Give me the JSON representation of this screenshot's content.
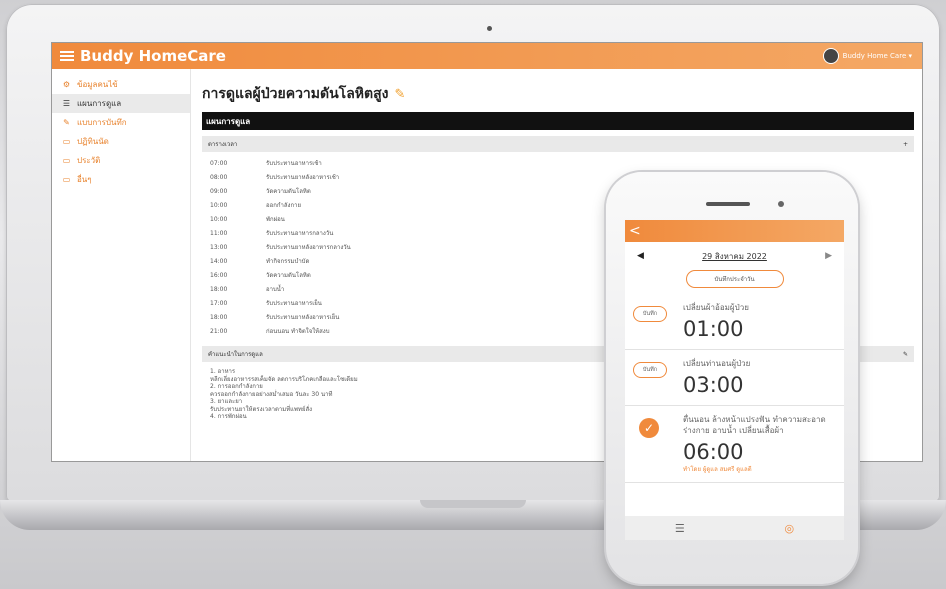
{
  "laptop_app": {
    "brand": "Buddy HomeCare",
    "user_menu": "Buddy Home Care ▾",
    "sidebar": [
      {
        "label": "ข้อมูลคนไข้",
        "icon": "gear-icon",
        "glyph": "⚙",
        "active": false
      },
      {
        "label": "แผนการดูแล",
        "icon": "list-icon",
        "glyph": "☰",
        "active": true
      },
      {
        "label": "แบบการบันทึก",
        "icon": "edit-icon",
        "glyph": "✎",
        "active": false
      },
      {
        "label": "ปฏิทินนัด",
        "icon": "calendar-icon",
        "glyph": "▭",
        "active": false
      },
      {
        "label": "ประวัติ",
        "icon": "history-icon",
        "glyph": "▭",
        "active": false
      },
      {
        "label": "อื่นๆ",
        "icon": "more-icon",
        "glyph": "▭",
        "active": false
      }
    ],
    "page_title": "การดูแลผู้ป่วยความดันโลหิตสูง",
    "section_title": "แผนการดูแล",
    "schedule_heading": "ตารางเวลา",
    "schedule_add": "+",
    "schedule": [
      {
        "time": "07:00",
        "task": "รับประทานอาหารเช้า"
      },
      {
        "time": "08:00",
        "task": "รับประทานยาหลังอาหารเช้า"
      },
      {
        "time": "09:00",
        "task": "วัดความดันโลหิต"
      },
      {
        "time": "10:00",
        "task": "ออกกำลังกาย"
      },
      {
        "time": "10:00",
        "task": "พักผ่อน"
      },
      {
        "time": "11:00",
        "task": "รับประทานอาหารกลางวัน"
      },
      {
        "time": "13:00",
        "task": "รับประทานยาหลังอาหารกลางวัน"
      },
      {
        "time": "14:00",
        "task": "ทำกิจกรรมบำบัด"
      },
      {
        "time": "16:00",
        "task": "วัดความดันโลหิต"
      },
      {
        "time": "18:00",
        "task": "อาบน้ำ"
      },
      {
        "time": "17:00",
        "task": "รับประทานอาหารเย็น"
      },
      {
        "time": "18:00",
        "task": "รับประทานยาหลังอาหารเย็น"
      },
      {
        "time": "21:00",
        "task": "ก่อนนอน ทำจิตใจให้สงบ"
      }
    ],
    "notes_heading": "คำแนะนำในการดูแล",
    "notes_edit": "✎",
    "notes": [
      "1. อาหาร",
      "หลีกเลี่ยงอาหารรสเค็มจัด ลดการบริโภคเกลือและโซเดียม",
      "2. การออกกำลังกาย",
      "ควรออกกำลังกายอย่างสม่ำเสมอ วันละ 30 นาที",
      "3. ยาและยา",
      "รับประทานยาให้ตรงเวลาตามที่แพทย์สั่ง",
      "4. การพักผ่อน"
    ]
  },
  "phone_app": {
    "back": "<",
    "date": "29 สิงหาคม 2022",
    "prev": "◀",
    "next": "▶",
    "today_button": "บันทึกประจำวัน",
    "tasks": [
      {
        "button": "บันทึก",
        "title": "เปลี่ยนผ้าอ้อมผู้ป่วย",
        "time": "01:00",
        "done": false,
        "note": ""
      },
      {
        "button": "บันทึก",
        "title": "เปลี่ยนท่านอนผู้ป่วย",
        "time": "03:00",
        "done": false,
        "note": ""
      },
      {
        "button": "",
        "title": "ตื่นนอน ล้างหน้าแปรงฟัน ทำความสะอาดร่างกาย อาบน้ำ เปลี่ยนเสื้อผ้า",
        "time": "06:00",
        "done": true,
        "note": "ทำโดย ผู้ดูแล สมศรี ดูแลดี"
      }
    ]
  },
  "colors": {
    "accent": "#f08a3c",
    "black_bar": "#111111"
  }
}
